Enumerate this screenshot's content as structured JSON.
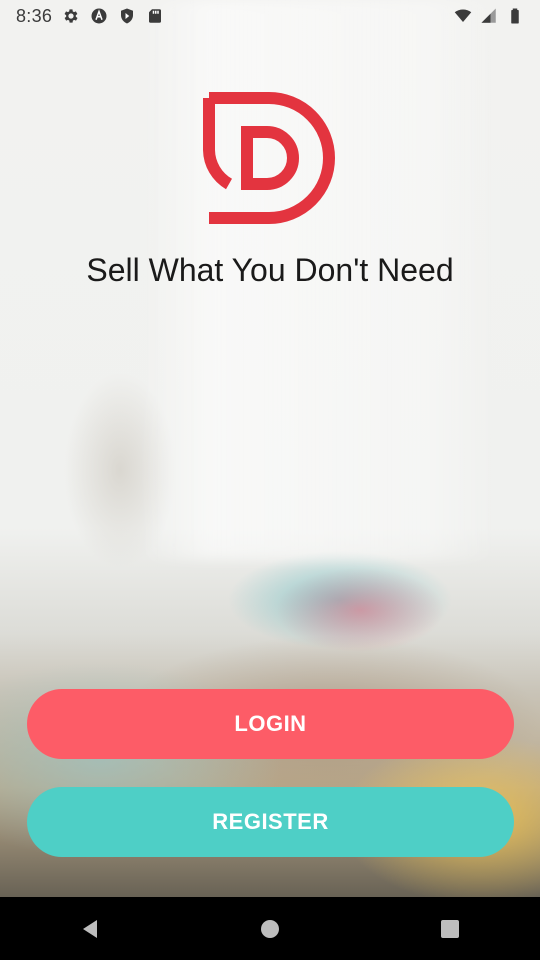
{
  "status_bar": {
    "time": "8:36",
    "icons_left": [
      "gear-icon",
      "a-icon",
      "shield-play-icon",
      "sd-card-icon"
    ],
    "icons_right": [
      "wifi-icon",
      "signal-icon",
      "battery-icon"
    ]
  },
  "brand": {
    "logo_icon": "d-logo-icon",
    "logo_color": "#e3343f",
    "tagline": "Sell What You Don't Need"
  },
  "actions": {
    "login_label": "LOGIN",
    "login_color": "#fd5c67",
    "register_label": "REGISTER",
    "register_color": "#4ecfc6"
  },
  "nav_bar": {
    "icons": [
      "back-icon",
      "home-icon",
      "recents-icon"
    ]
  }
}
